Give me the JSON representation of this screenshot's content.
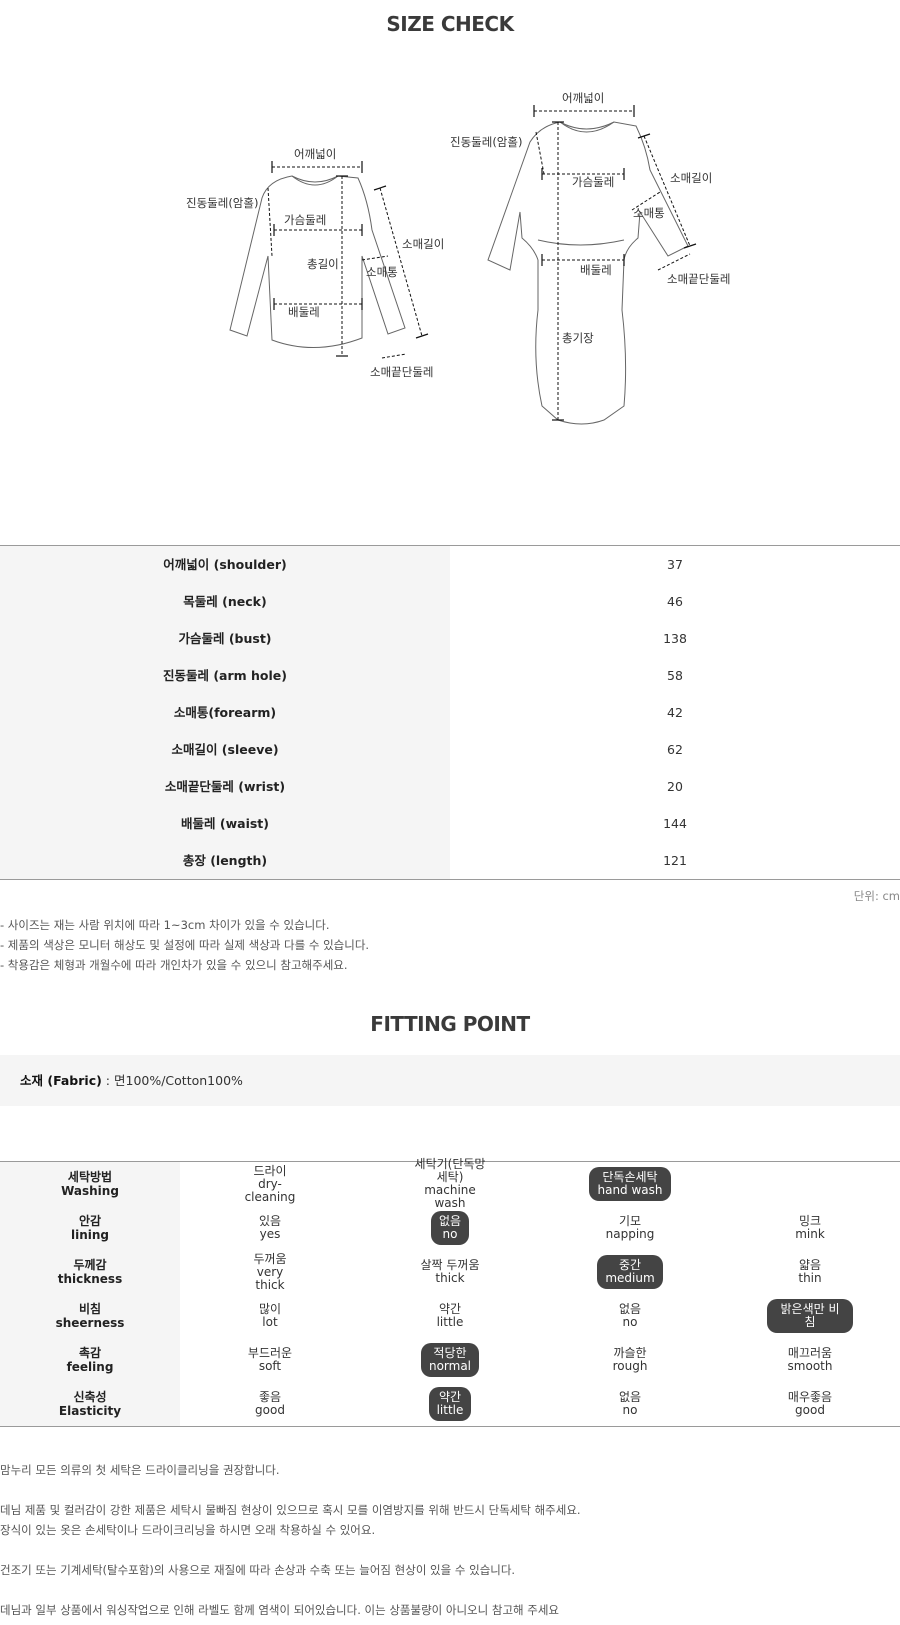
{
  "size_check": {
    "title": "SIZE CHECK",
    "left_labels": {
      "shoulder": "어깨넓이",
      "armhole": "진동둘레(암홀)",
      "bust": "가슴둘레",
      "length": "총길이",
      "forearm": "소매통",
      "sleeve": "소매길이",
      "waist": "배둘레",
      "wrist": "소매끝단둘레"
    },
    "right_labels": {
      "shoulder": "어깨넓이",
      "armhole": "진동둘레(암홀)",
      "bust": "가슴둘레",
      "sleeve": "소매길이",
      "forearm": "소매통",
      "wrist": "소매끝단둘레",
      "waist": "배둘레",
      "length": "총기장"
    },
    "rows": [
      {
        "label": "어깨넓이 (shoulder)",
        "value": "37"
      },
      {
        "label": "목둘레 (neck)",
        "value": "46"
      },
      {
        "label": "가슴둘레 (bust)",
        "value": "138"
      },
      {
        "label": "진동둘레 (arm hole)",
        "value": "58"
      },
      {
        "label": "소매통(forearm)",
        "value": "42"
      },
      {
        "label": "소매길이 (sleeve)",
        "value": "62"
      },
      {
        "label": "소매끝단둘레 (wrist)",
        "value": "20"
      },
      {
        "label": "배둘레 (waist)",
        "value": "144"
      },
      {
        "label": "총장 (length)",
        "value": "121"
      }
    ],
    "unit": "단위: cm",
    "notes": [
      "- 사이즈는 재는 사람 위치에 따라 1~3cm 차이가 있을 수 있습니다.",
      "- 제품의 색상은 모니터 해상도 및 설정에 따라 실제 색상과 다를 수 있습니다.",
      "- 착용감은 체형과 개월수에 따라 개인차가 있을 수 있으니 참고해주세요."
    ]
  },
  "fitting_point": {
    "title": "FITTING POINT",
    "fabric_label": "소재 (Fabric)",
    "fabric_value": " : 면100%/Cotton100%",
    "rows": [
      {
        "ko": "세탁방법",
        "en": "Washing",
        "options": [
          "드라이\ndry-cleaning",
          "세탁기(단독망세탁)\nmachine wash",
          "단독손세탁\nhand wash",
          ""
        ],
        "selected": 2
      },
      {
        "ko": "안감",
        "en": "lining",
        "options": [
          "있음\nyes",
          "없음\nno",
          "기모\nnapping",
          "밍크\nmink"
        ],
        "selected": 1
      },
      {
        "ko": "두께감",
        "en": "thickness",
        "options": [
          "두꺼움\nvery\nthick",
          "살짝 두꺼움\nthick",
          "중간\nmedium",
          "얇음\nthin"
        ],
        "selected": 2
      },
      {
        "ko": "비침",
        "en": "sheerness",
        "options": [
          "많이\nlot",
          "약간\nlittle",
          "없음\nno",
          "밝은색만 비침"
        ],
        "selected": 3
      },
      {
        "ko": "촉감",
        "en": "feeling",
        "options": [
          "부드러운\nsoft",
          "적당한\nnormal",
          "까슬한\nrough",
          "매끄러움\nsmooth"
        ],
        "selected": 1
      },
      {
        "ko": "신축성",
        "en": "Elasticity",
        "options": [
          "좋음\ngood",
          "약간\nlittle",
          "없음\nno",
          "매우좋음\ngood"
        ],
        "selected": 1
      }
    ]
  },
  "care_notes": [
    "맘누리 모든 의류의 첫 세탁은 드라이클리닝을 권장합니다.",
    "",
    "데님 제품 및 컬러감이 강한 제품은 세탁시 물빠짐 현상이 있으므로 혹시 모를 이염방지를 위해 반드시 단독세탁 해주세요.",
    "장식이 있는 옷은 손세탁이나 드라이크리닝을 하시면 오래 착용하실 수 있어요.",
    "",
    "건조기 또는 기계세탁(탈수포함)의 사용으로 재질에 따라 손상과 수축 또는 늘어짐 현상이 있을 수 있습니다.",
    "",
    "데님과 일부 상품에서 워싱작업으로 인해 라벨도 함께 염색이 되어있습니다. 이는 상품불량이 아니오니 참고해 주세요"
  ]
}
